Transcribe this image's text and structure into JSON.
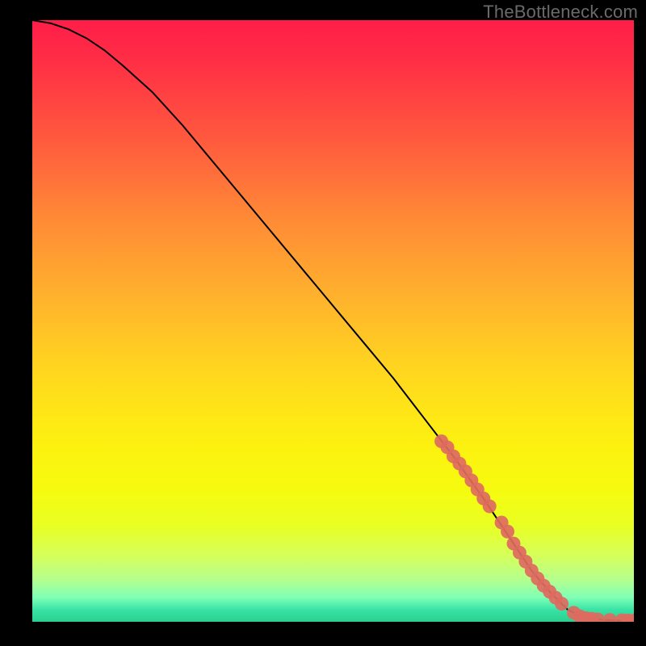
{
  "watermark": "TheBottleneck.com",
  "chart_data": {
    "type": "line",
    "title": "",
    "xlabel": "",
    "ylabel": "",
    "xlim": [
      0,
      100
    ],
    "ylim": [
      0,
      100
    ],
    "grid": false,
    "legend": null,
    "series": [
      {
        "name": "curve",
        "type": "line",
        "color": "#000000",
        "x": [
          0,
          3,
          6,
          9,
          12,
          15,
          20,
          25,
          30,
          35,
          40,
          45,
          50,
          55,
          60,
          65,
          70,
          75,
          80,
          83,
          86,
          89,
          92,
          95,
          98,
          100
        ],
        "y": [
          100,
          99.5,
          98.5,
          97,
          95,
          92.5,
          88,
          82.5,
          76.5,
          70.5,
          64.5,
          58.5,
          52.5,
          46.5,
          40.5,
          34,
          27.5,
          20.5,
          13,
          8.5,
          5,
          2,
          0.6,
          0.3,
          0.2,
          0.2
        ]
      },
      {
        "name": "highlight-points",
        "type": "scatter",
        "color": "#de6a60",
        "x": [
          68,
          69,
          70,
          71,
          72,
          73,
          74,
          75,
          76,
          78,
          79,
          80,
          81,
          82,
          83,
          84,
          85,
          86,
          87,
          88,
          90,
          91,
          92,
          93,
          94,
          96,
          98,
          99,
          100
        ],
        "y": [
          30,
          29,
          27.5,
          26.3,
          25,
          23.5,
          22,
          20.5,
          19.2,
          16.5,
          15,
          13,
          11.5,
          10,
          8.5,
          7.2,
          6,
          5,
          4,
          3,
          1.5,
          0.9,
          0.6,
          0.5,
          0.4,
          0.3,
          0.25,
          0.22,
          0.2
        ]
      }
    ]
  }
}
